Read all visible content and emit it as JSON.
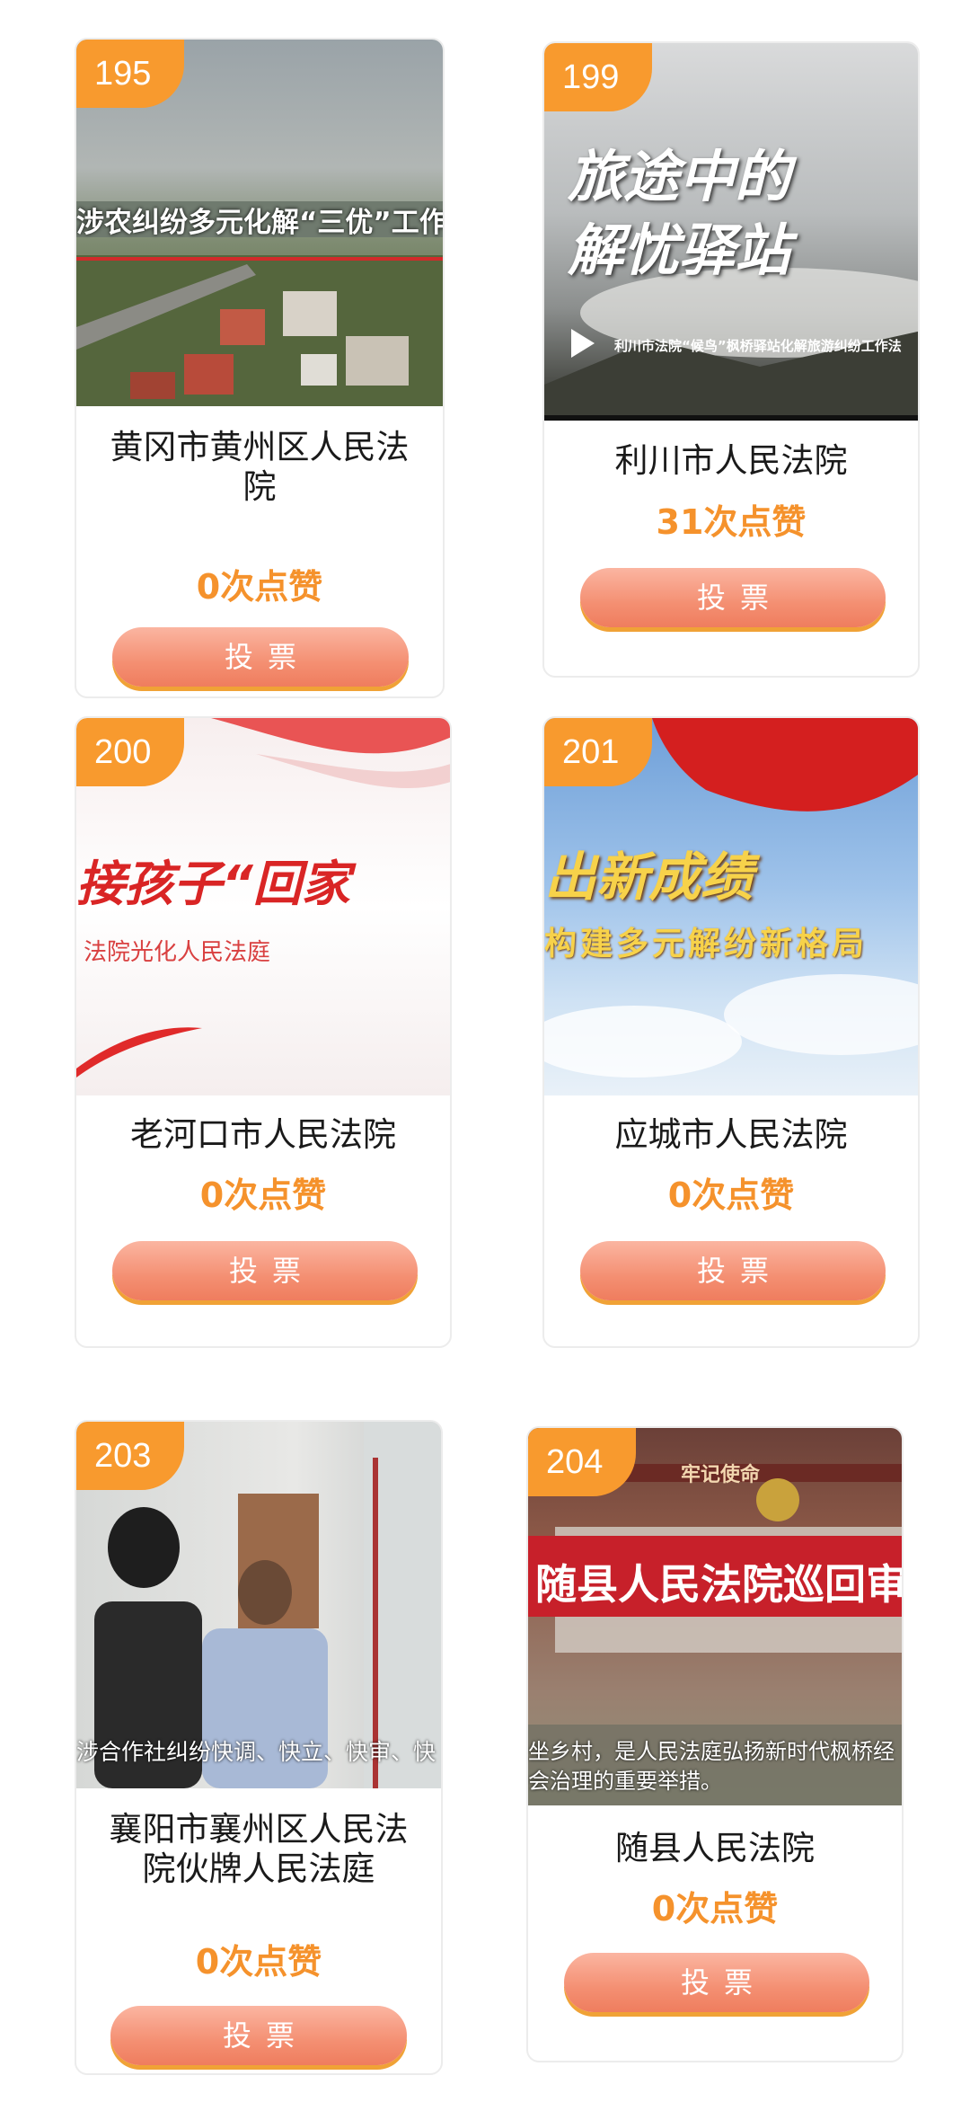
{
  "cards": [
    {
      "id": "195",
      "title": "黄冈市黄州区人民法院",
      "likes": "0次点赞",
      "vote": "投票",
      "thumb_caption": "涉农纠纷多元化解“三优”工作法"
    },
    {
      "id": "199",
      "title": "利川市人民法院",
      "likes": "31次点赞",
      "vote": "投票",
      "thumb_caption_line1": "旅途中的",
      "thumb_caption_line2": "解忧驿站",
      "thumb_subcaption": "利川市法院“候鸟”枫桥驿站化解旅游纠纷工作法"
    },
    {
      "id": "200",
      "title": "老河口市人民法院",
      "likes": "0次点赞",
      "vote": "投票",
      "thumb_caption": "接孩子“回家",
      "thumb_subcaption": "法院光化人民法庭"
    },
    {
      "id": "201",
      "title": "应城市人民法院",
      "likes": "0次点赞",
      "vote": "投票",
      "thumb_caption": "出新成绩",
      "thumb_subcaption": "构建多元解纷新格局"
    },
    {
      "id": "203",
      "title": "襄阳市襄州区人民法院伙牌人民法庭",
      "likes": "0次点赞",
      "vote": "投票",
      "thumb_caption": "涉合作社纠纷快调、快立、快审、快"
    },
    {
      "id": "204",
      "title": "随县人民法院",
      "likes": "0次点赞",
      "vote": "投票",
      "thumb_banner": "随县人民法院巡回审判",
      "thumb_top_sign": "牢记使命",
      "thumb_caption_line1": "坐乡村，是人民法庭弘扬新时代枫桥经",
      "thumb_caption_line2": "会治理的重要举措。"
    }
  ],
  "colors": {
    "badge": "#f89a2e",
    "likes": "#f5922c",
    "vote_top": "#fbb5a1",
    "vote_bottom": "#ef7d5e",
    "vote_shadow": "#f0a236"
  }
}
